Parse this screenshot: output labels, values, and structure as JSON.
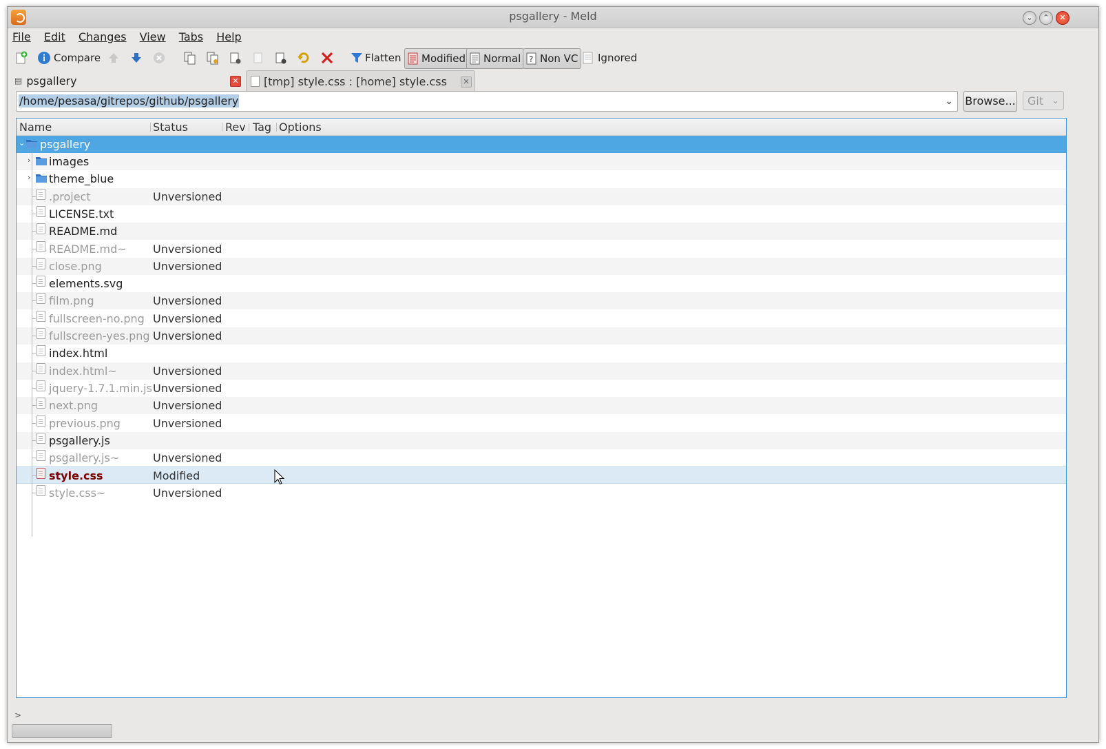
{
  "window": {
    "title": "psgallery - Meld"
  },
  "menu": [
    {
      "label": "File"
    },
    {
      "label": "Edit"
    },
    {
      "label": "Changes"
    },
    {
      "label": "View"
    },
    {
      "label": "Tabs"
    },
    {
      "label": "Help"
    }
  ],
  "toolbar": {
    "compare": "Compare",
    "flatten": "Flatten",
    "modified": "Modified",
    "normal": "Normal",
    "nonvc": "Non VC",
    "ignored": "Ignored"
  },
  "tabs": [
    {
      "label": "psgallery",
      "active": true
    },
    {
      "label": "[tmp] style.css : [home] style.css",
      "active": false
    }
  ],
  "location": {
    "path": "/home/pesasa/gitrepos/github/psgallery",
    "browse": "Browse...",
    "vcs": "Git"
  },
  "columns": [
    "Name",
    "Status",
    "Rev",
    "Tag",
    "Options"
  ],
  "tree": {
    "root": "psgallery",
    "rows": [
      {
        "name": "images",
        "type": "folder",
        "status": ""
      },
      {
        "name": "theme_blue",
        "type": "folder",
        "status": ""
      },
      {
        "name": ".project",
        "type": "file",
        "status": "Unversioned"
      },
      {
        "name": "LICENSE.txt",
        "type": "file",
        "status": ""
      },
      {
        "name": "README.md",
        "type": "file",
        "status": ""
      },
      {
        "name": "README.md~",
        "type": "file",
        "status": "Unversioned"
      },
      {
        "name": "close.png",
        "type": "file",
        "status": "Unversioned"
      },
      {
        "name": "elements.svg",
        "type": "file",
        "status": ""
      },
      {
        "name": "film.png",
        "type": "file",
        "status": "Unversioned"
      },
      {
        "name": "fullscreen-no.png",
        "type": "file",
        "status": "Unversioned"
      },
      {
        "name": "fullscreen-yes.png",
        "type": "file",
        "status": "Unversioned"
      },
      {
        "name": "index.html",
        "type": "file",
        "status": ""
      },
      {
        "name": "index.html~",
        "type": "file",
        "status": "Unversioned"
      },
      {
        "name": "jquery-1.7.1.min.js",
        "type": "file",
        "status": "Unversioned"
      },
      {
        "name": "next.png",
        "type": "file",
        "status": "Unversioned"
      },
      {
        "name": "previous.png",
        "type": "file",
        "status": "Unversioned"
      },
      {
        "name": "psgallery.js",
        "type": "file",
        "status": ""
      },
      {
        "name": "psgallery.js~",
        "type": "file",
        "status": "Unversioned"
      },
      {
        "name": "style.css",
        "type": "file",
        "status": "Modified"
      },
      {
        "name": "style.css~",
        "type": "file",
        "status": "Unversioned"
      }
    ]
  },
  "colors": {
    "selection": "#4ea7e3",
    "modified_text": "#7a0000",
    "unversioned_text": "#9b9b9b",
    "tree_border": "#3e95d0"
  }
}
